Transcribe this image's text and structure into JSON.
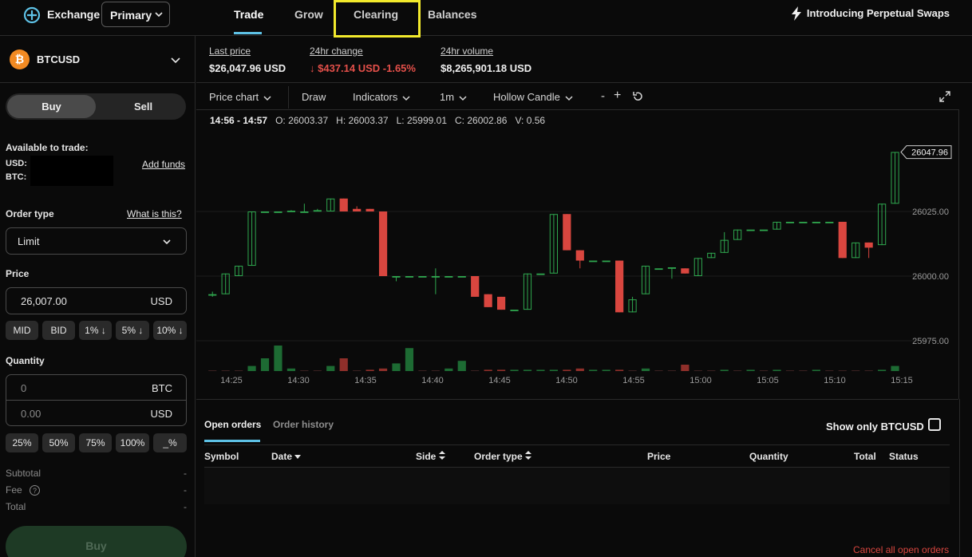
{
  "header": {
    "brand": "Exchange",
    "account": "Primary",
    "tabs": [
      "Trade",
      "Grow",
      "Clearing",
      "Balances"
    ],
    "active_tab": "Trade",
    "promo": "Introducing Perpetual Swaps"
  },
  "pair": {
    "symbol": "BTCUSD",
    "coin_glyph": "₿"
  },
  "order_form": {
    "buy_label": "Buy",
    "sell_label": "Sell",
    "available_label": "Available to trade:",
    "usd_label": "USD:",
    "btc_label": "BTC:",
    "add_funds": "Add funds",
    "order_type_label": "Order type",
    "what_is_this": "What is this?",
    "order_type_value": "Limit",
    "price_label": "Price",
    "price_value": "26,007.00",
    "price_unit": "USD",
    "price_chips": [
      "MID",
      "BID",
      "1% ↓",
      "5% ↓",
      "10% ↓"
    ],
    "quantity_label": "Quantity",
    "qty_btc_value": "0",
    "qty_btc_unit": "BTC",
    "qty_usd_value": "0.00",
    "qty_usd_unit": "USD",
    "pct_chips": [
      "25%",
      "50%",
      "75%",
      "100%",
      "_%"
    ],
    "subtotal_label": "Subtotal",
    "fee_label": "Fee",
    "total_label": "Total",
    "dash": "-",
    "submit": "Buy"
  },
  "stats": {
    "last_price_label": "Last price",
    "last_price": "$26,047.96 USD",
    "change_label": "24hr change",
    "change": "↓ $437.14 USD -1.65%",
    "volume_label": "24hr volume",
    "volume": "$8,265,901.18 USD"
  },
  "toolbar": {
    "price_chart": "Price chart",
    "draw": "Draw",
    "indicators": "Indicators",
    "interval": "1m",
    "candle_style": "Hollow Candle",
    "minus": "-",
    "plus": "+"
  },
  "ohlc": {
    "range": "14:56 - 14:57",
    "o_label": "O:",
    "o": "26003.37",
    "h_label": "H:",
    "h": "26003.37",
    "l_label": "L:",
    "l": "25999.01",
    "c_label": "C:",
    "c": "26002.86",
    "v_label": "V:",
    "v": "0.56"
  },
  "chart_data": {
    "type": "candlestick",
    "current_price_label": "26047.96",
    "y_ticks": [
      26025.0,
      26000.0,
      25975.0
    ],
    "y_tick_labels": [
      "26025.00",
      "26000.00",
      "25975.00"
    ],
    "x_tick_labels": [
      "14:25",
      "14:30",
      "14:35",
      "14:40",
      "14:45",
      "14:50",
      "14:55",
      "15:00",
      "15:05",
      "15:10",
      "15:15"
    ],
    "up_color": "#2fa84f",
    "down_color": "#d9463f",
    "candles": [
      {
        "o": 25993,
        "c": 25993,
        "h": 25994,
        "l": 25992
      },
      {
        "o": 25993,
        "c": 26001,
        "h": 26001,
        "l": 25993
      },
      {
        "o": 26000,
        "c": 26004,
        "h": 26004,
        "l": 26000
      },
      {
        "o": 26004,
        "c": 26025,
        "h": 26025,
        "l": 26004
      },
      {
        "o": 26025,
        "c": 26025,
        "h": 26025,
        "l": 26025
      },
      {
        "o": 26025,
        "c": 26025,
        "h": 26025,
        "l": 26025
      },
      {
        "o": 26025,
        "c": 26025.3,
        "h": 26025.5,
        "l": 26025
      },
      {
        "o": 26025,
        "c": 26025,
        "h": 26028,
        "l": 26025
      },
      {
        "o": 26025,
        "c": 26025.5,
        "h": 26026,
        "l": 26025
      },
      {
        "o": 26025,
        "c": 26030,
        "h": 26030,
        "l": 26025
      },
      {
        "o": 26030,
        "c": 26025,
        "h": 26030,
        "l": 26025
      },
      {
        "o": 26026,
        "c": 26025,
        "h": 26027,
        "l": 26025
      },
      {
        "o": 26026,
        "c": 26025,
        "h": 26026,
        "l": 26025
      },
      {
        "o": 26025,
        "c": 26000,
        "h": 26025,
        "l": 26000
      },
      {
        "o": 26000,
        "c": 26000,
        "h": 26000,
        "l": 25998
      },
      {
        "o": 26000,
        "c": 26000,
        "h": 26000,
        "l": 26000
      },
      {
        "o": 26000,
        "c": 26000,
        "h": 26000,
        "l": 26000
      },
      {
        "o": 26000,
        "c": 26000,
        "h": 26003,
        "l": 25993
      },
      {
        "o": 26000,
        "c": 26000,
        "h": 26000,
        "l": 26000
      },
      {
        "o": 26000,
        "c": 26000,
        "h": 26000,
        "l": 26000
      },
      {
        "o": 26000,
        "c": 25992,
        "h": 26000,
        "l": 25992
      },
      {
        "o": 25993,
        "c": 25988,
        "h": 25993,
        "l": 25988
      },
      {
        "o": 25992,
        "c": 25987,
        "h": 25992,
        "l": 25987
      },
      {
        "o": 25987,
        "c": 25987,
        "h": 25987,
        "l": 25987
      },
      {
        "o": 25987,
        "c": 26001,
        "h": 26001,
        "l": 25987
      },
      {
        "o": 26001,
        "c": 26001,
        "h": 26001,
        "l": 26001
      },
      {
        "o": 26001,
        "c": 26024,
        "h": 26024,
        "l": 26001
      },
      {
        "o": 26024,
        "c": 26010,
        "h": 26024,
        "l": 26010
      },
      {
        "o": 26010,
        "c": 26006,
        "h": 26010,
        "l": 26003
      },
      {
        "o": 26006,
        "c": 26006,
        "h": 26006,
        "l": 26006
      },
      {
        "o": 26006,
        "c": 26006,
        "h": 26006,
        "l": 26006
      },
      {
        "o": 26006,
        "c": 25986,
        "h": 26006,
        "l": 25986
      },
      {
        "o": 25986,
        "c": 25991,
        "h": 25992,
        "l": 25986
      },
      {
        "o": 25993,
        "c": 26004,
        "h": 26004,
        "l": 25993
      },
      {
        "o": 26003,
        "c": 26003,
        "h": 26003,
        "l": 26003
      },
      {
        "o": 26003,
        "c": 26003.4,
        "h": 26003.4,
        "l": 25999
      },
      {
        "o": 26003,
        "c": 26001,
        "h": 26003,
        "l": 26001
      },
      {
        "o": 26000,
        "c": 26007,
        "h": 26007,
        "l": 26000
      },
      {
        "o": 26007,
        "c": 26009,
        "h": 26009,
        "l": 26007
      },
      {
        "o": 26009,
        "c": 26014,
        "h": 26017,
        "l": 26009
      },
      {
        "o": 26014,
        "c": 26018,
        "h": 26018,
        "l": 26014
      },
      {
        "o": 26018,
        "c": 26018,
        "h": 26018,
        "l": 26018
      },
      {
        "o": 26018,
        "c": 26018,
        "h": 26018,
        "l": 26018
      },
      {
        "o": 26018,
        "c": 26021,
        "h": 26021,
        "l": 26018
      },
      {
        "o": 26021,
        "c": 26021,
        "h": 26021,
        "l": 26021
      },
      {
        "o": 26021,
        "c": 26021,
        "h": 26021,
        "l": 26021
      },
      {
        "o": 26021,
        "c": 26021,
        "h": 26021,
        "l": 26021
      },
      {
        "o": 26021,
        "c": 26021,
        "h": 26021,
        "l": 26021
      },
      {
        "o": 26021,
        "c": 26007,
        "h": 26021,
        "l": 26007
      },
      {
        "o": 26007,
        "c": 26013,
        "h": 26013,
        "l": 26007
      },
      {
        "o": 26013,
        "c": 26011,
        "h": 26013,
        "l": 26007
      },
      {
        "o": 26012,
        "c": 26028,
        "h": 26028,
        "l": 26012
      },
      {
        "o": 26028,
        "c": 26048,
        "h": 26048,
        "l": 26028
      }
    ],
    "volumes": [
      0,
      0,
      0,
      0.2,
      0.5,
      1.0,
      0.1,
      0,
      0,
      0.2,
      0.5,
      0,
      0.05,
      0.1,
      0.3,
      0.9,
      0,
      0,
      0.1,
      0.4,
      0,
      0.05,
      0.05,
      0.05,
      0.05,
      0.05,
      0.05,
      0.05,
      0.1,
      0.05,
      0.05,
      0.05,
      0,
      0.1,
      0,
      0,
      0.25,
      0,
      0,
      0.05,
      0,
      0.05,
      0,
      0.05,
      0,
      0,
      0.05,
      0,
      0,
      0,
      0,
      0.05,
      0.2,
      0
    ]
  },
  "orders": {
    "tabs": [
      "Open orders",
      "Order history"
    ],
    "show_only": "Show only BTCUSD",
    "columns": [
      "Symbol",
      "Date",
      "Side",
      "Order type",
      "Price",
      "Quantity",
      "Total",
      "Status"
    ],
    "cancel_all": "Cancel all open orders"
  },
  "colors": {
    "accent": "#5ec2e6",
    "highlight": "#f3ea2c",
    "up": "#2fa84f",
    "down": "#d9463f",
    "coin": "#f28a22"
  }
}
